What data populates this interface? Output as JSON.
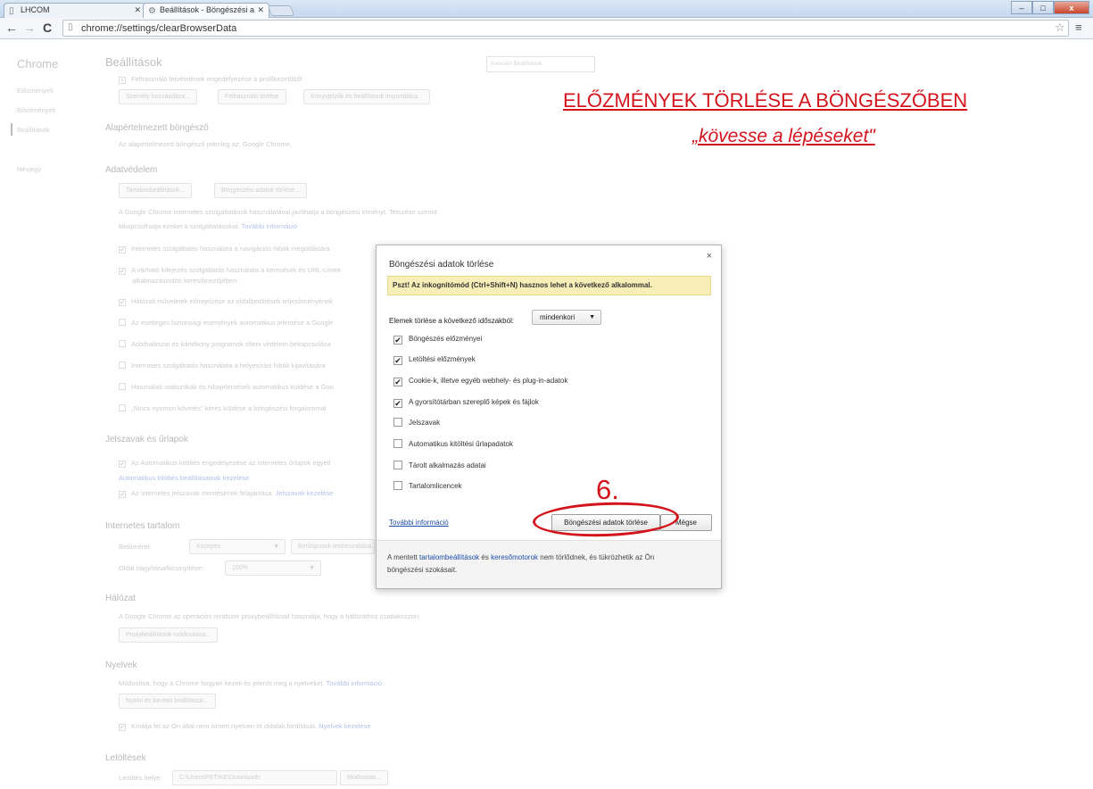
{
  "window": {
    "tabs": [
      {
        "title": "LHCOM",
        "icon": "page-icon"
      },
      {
        "title": "Beállítások - Böngészési a",
        "icon": "gear-icon"
      }
    ],
    "controls": {
      "minimize": "–",
      "maximize": "□",
      "close": "x"
    }
  },
  "toolbar": {
    "url": "chrome://settings/clearBrowserData"
  },
  "sidebar": {
    "brand": "Chrome",
    "items": [
      "Előzmények",
      "Bővítmények",
      "Beállítások",
      "Névjegy"
    ]
  },
  "settings": {
    "title": "Beállítások",
    "search_placeholder": "Keresés Beállítások",
    "users_text": "Felhasználó felvételének engedélyezése a profilkezelőből",
    "users_buttons": [
      "Személy hozzáadása...",
      "Felhasználó törlése",
      "Könyvjelzők és beállítások importálása..."
    ],
    "default_browser": {
      "heading": "Alapértelmezett böngésző",
      "text": "Az alapértelmezett böngésző jelenleg az: Google Chrome."
    },
    "privacy": {
      "heading": "Adatvédelem",
      "buttons": [
        "Tartalombeállítások...",
        "Böngészési adatok törlése..."
      ],
      "text1": "A Google Chrome internetes szolgáltatások használatával javíthatja a böngészési élményt. Tetszése szerint",
      "text2": "kikapcsolhatja ezeket a szolgáltatásokat.",
      "link": "További információ",
      "options": [
        "Internetes szolgáltatás használata a navigációs hibák megoldására",
        "A várható kifejezés szolgáltatás használata a keresések és URL-címek",
        "alkalmazásindító keresőmezőjében",
        "Hálózati műveletek előrejelzése az oldalbetöltések teljesítményének",
        "Az esetleges biztonsági események automatikus jelentése a Google",
        "Adathalászat és kártékony programok elleni védelem bekapcsolása",
        "Internetes szolgáltatás használata a helyesírási hibák kijavítására",
        "Használati statisztikák és hibajelentések automatikus küldése a Goo",
        "„Nincs nyomon követés\" kérés küldése a böngészési forgalommal"
      ]
    },
    "passwords": {
      "heading": "Jelszavak és űrlapok",
      "opt1": "Az Automatikus kitöltés engedélyezése az internetes űrlapok egyetl",
      "link1": "Automatikus kitöltés beállításainak kezelése",
      "opt2": "Az internetes jelszavak mentésének felajánlása.",
      "link2": "Jelszavak kezelése"
    },
    "web_content": {
      "heading": "Internetes tartalom",
      "font_label": "Betűméret:",
      "font_value": "Közepes",
      "font_button": "Betűtípusok testreszabása...",
      "zoom_label": "Oldal nagyítása/kicsinyítése:",
      "zoom_value": "100%"
    },
    "network": {
      "heading": "Hálózat",
      "text": "A Google Chrome az operációs rendszer proxybeállításait használja, hogy a hálózathoz csatlakozzon.",
      "button": "Proxybeállítások módosítása..."
    },
    "languages": {
      "heading": "Nyelvek",
      "text": "Módosítsa, hogy a Chrome hogyan kezeli és jeleníti meg a nyelveket.",
      "link": "További információ",
      "button": "Nyelvi és beviteli beállítások...",
      "opt": "Kínálja fel az Ön által nem ismert nyelven írt oldalak fordítását.",
      "opt_link": "Nyelvek kezelése"
    },
    "downloads": {
      "heading": "Letöltések",
      "label": "Letöltés helye:",
      "path": "C:\\Users\\PETIKE\\Downloads",
      "button": "Módosítás..."
    }
  },
  "annotation": {
    "title": "ELŐZMÉNYEK TÖRLÉSE A BÖNGÉSZŐBEN",
    "subtitle": "„kövesse a lépéseket\"",
    "step": "6."
  },
  "dialog": {
    "title": "Böngészési adatok törlése",
    "close": "×",
    "banner": "Pszt! Az inkognitómód (Ctrl+Shift+N) hasznos lehet a következő alkalommal.",
    "period_label": "Elemek törlése a következő időszakból:",
    "period_value": "mindenkori",
    "options": [
      {
        "label": "Böngészés előzményei",
        "checked": true
      },
      {
        "label": "Letöltési előzmények",
        "checked": true
      },
      {
        "label": "Cookie-k, illetve egyéb webhely- és plug-in-adatok",
        "checked": true
      },
      {
        "label": "A gyorsítótárban szereplő képek és fájlok",
        "checked": true
      },
      {
        "label": "Jelszavak",
        "checked": false
      },
      {
        "label": "Automatikus kitöltési űrlapadatok",
        "checked": false
      },
      {
        "label": "Tárolt alkalmazás adatai",
        "checked": false
      },
      {
        "label": "Tartalomlicencek",
        "checked": false
      }
    ],
    "more_link": "További információ",
    "clear_button": "Böngészési adatok törlése",
    "cancel_button": "Mégse",
    "footer_pre": "A mentett",
    "footer_link1": "tartalombeállítások",
    "footer_mid": "és",
    "footer_link2": "keresőmotorok",
    "footer_post": "nem törlődnek, és tükrözhetik az Ön",
    "footer_line2": "böngészési szokásait."
  }
}
